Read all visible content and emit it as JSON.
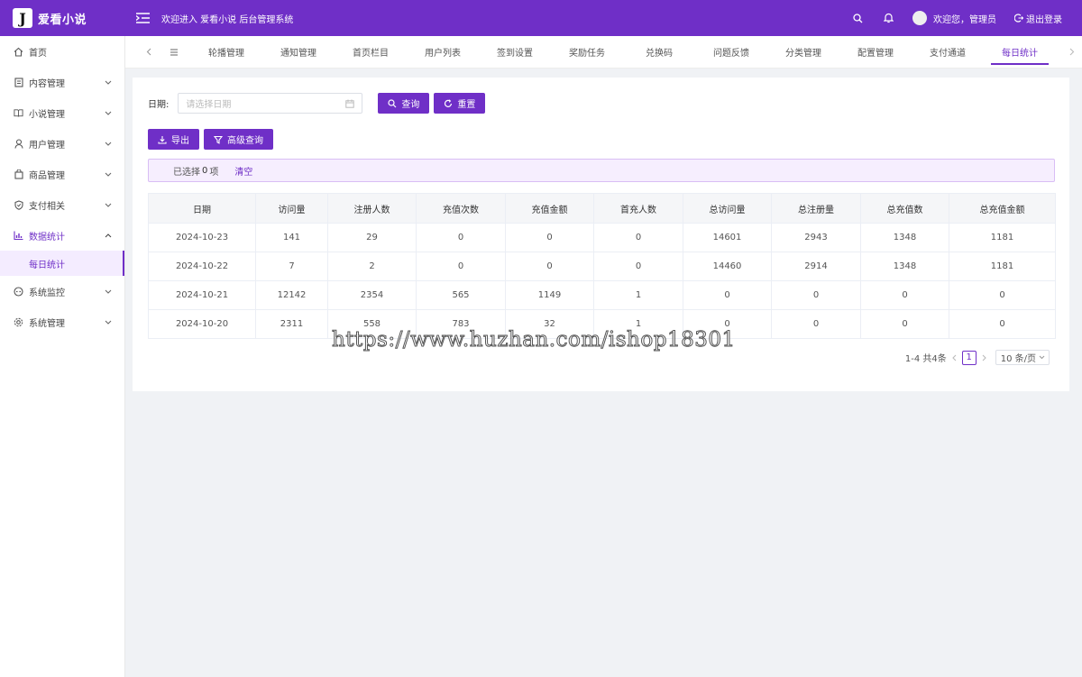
{
  "header": {
    "logo_glyph": "J",
    "app_name": "爱看小说",
    "welcome_title": "欢迎进入 爱看小说 后台管理系统",
    "greeting": "欢迎您，管理员",
    "logout_label": "退出登录",
    "bg_color": "#6f2fc7"
  },
  "sidebar": {
    "items": [
      {
        "label": "首页",
        "icon": "home-icon"
      },
      {
        "label": "内容管理",
        "icon": "document-icon"
      },
      {
        "label": "小说管理",
        "icon": "book-icon"
      },
      {
        "label": "用户管理",
        "icon": "user-icon"
      },
      {
        "label": "商品管理",
        "icon": "bag-icon"
      },
      {
        "label": "支付相关",
        "icon": "shield-icon"
      },
      {
        "label": "数据统计",
        "icon": "chart-icon"
      },
      {
        "label": "系统监控",
        "icon": "monitor-icon"
      },
      {
        "label": "系统管理",
        "icon": "gear-icon"
      }
    ],
    "sub_item": "每日统计"
  },
  "tabs": [
    "轮播管理",
    "通知管理",
    "首页栏目",
    "用户列表",
    "签到设置",
    "奖励任务",
    "兑换码",
    "问题反馈",
    "分类管理",
    "配置管理",
    "支付通道",
    "每日统计"
  ],
  "filter": {
    "date_label": "日期:",
    "date_placeholder": "请选择日期",
    "query_label": "查询",
    "reset_label": "重置"
  },
  "actions": {
    "export_label": "导出",
    "advanced_label": "高级查询"
  },
  "selection": {
    "prefix": "已选择",
    "count": "0",
    "suffix": "项",
    "clear_label": "清空"
  },
  "table": {
    "headers": [
      "日期",
      "访问量",
      "注册人数",
      "充值次数",
      "充值金额",
      "首充人数",
      "总访问量",
      "总注册量",
      "总充值数",
      "总充值金额"
    ],
    "rows": [
      [
        "2024-10-23",
        "141",
        "29",
        "0",
        "0",
        "0",
        "14601",
        "2943",
        "1348",
        "1181"
      ],
      [
        "2024-10-22",
        "7",
        "2",
        "0",
        "0",
        "0",
        "14460",
        "2914",
        "1348",
        "1181"
      ],
      [
        "2024-10-21",
        "12142",
        "2354",
        "565",
        "1149",
        "1",
        "0",
        "0",
        "0",
        "0"
      ],
      [
        "2024-10-20",
        "2311",
        "558",
        "783",
        "32",
        "1",
        "0",
        "0",
        "0",
        "0"
      ]
    ]
  },
  "pagination": {
    "summary": "1-4 共4条",
    "current_page": "1",
    "page_size": "10 条/页"
  },
  "watermark": "https://www.huzhan.com/ishop18301"
}
